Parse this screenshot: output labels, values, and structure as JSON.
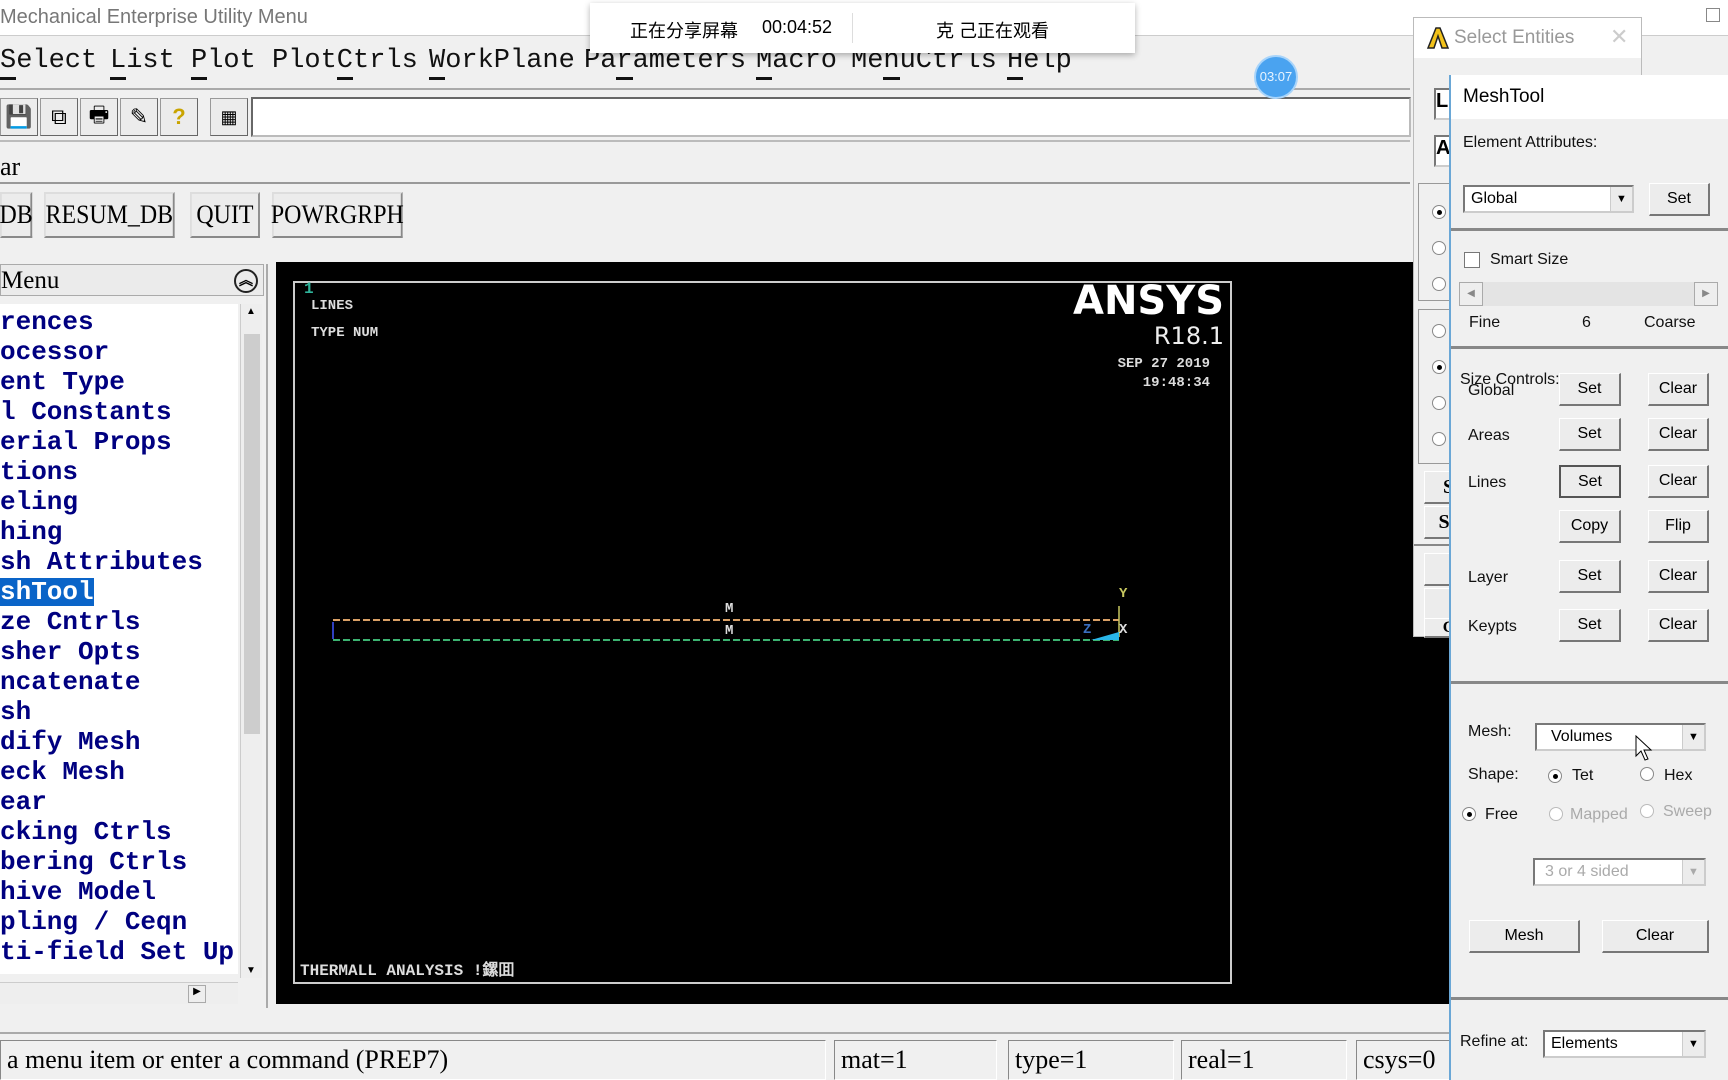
{
  "window": {
    "title": "Mechanical Enterprise Utility Menu"
  },
  "menubar": [
    {
      "label": "Select",
      "key": "S"
    },
    {
      "label": "List",
      "key": "L"
    },
    {
      "label": "Plot",
      "key": "P"
    },
    {
      "label": "PlotCtrls",
      "key": "C"
    },
    {
      "label": "WorkPlane",
      "key": "W"
    },
    {
      "label": "Parameters",
      "key": "r"
    },
    {
      "label": "Macro",
      "key": "M"
    },
    {
      "label": "MenuCtrls",
      "key": "n"
    },
    {
      "label": "Help",
      "key": "H"
    }
  ],
  "toolbar": {
    "icons": [
      "save-icon",
      "resume-icon",
      "print-icon",
      "report-icon",
      "help-icon",
      "keyboard-icon"
    ],
    "command_value": ""
  },
  "toolbar_label": "ar",
  "buttons": [
    "DB",
    "RESUM_DB",
    "QUIT",
    "POWRGRPH"
  ],
  "main_menu": {
    "title": "Menu",
    "items": [
      "rences",
      "ocessor",
      "ent Type",
      "l Constants",
      "erial Props",
      "tions",
      "eling",
      "hing",
      "sh Attributes",
      "shTool",
      "ze Cntrls",
      "sher Opts",
      "ncatenate",
      "sh",
      "dify Mesh",
      "eck Mesh",
      "ear",
      "cking Ctrls",
      "bering Ctrls",
      "hive Model",
      "pling / Ceqn",
      "ti-field Set Up"
    ],
    "selected": "shTool"
  },
  "graphics": {
    "window_number": "1",
    "label1": "LINES",
    "label2": "TYPE NUM",
    "brand": "ANSYS",
    "version": "R18.1",
    "date": "SEP 27 2019",
    "time": "19:48:34",
    "title": "THERMALL ANALYSIS !鏍囬",
    "marker1": "M",
    "marker2": "M",
    "axis_y": "Y",
    "axis_z": "Z",
    "axis_x": "X",
    "colors": {
      "top_line": "#d9a066",
      "bottom_line": "#3cb371",
      "triad": "#29b6e8"
    }
  },
  "status": {
    "prompt": "a menu item or enter a command (PREP7)",
    "mat": "mat=1",
    "type": "type=1",
    "real": "real=1",
    "csys": "csys=0"
  },
  "share_overlay": {
    "status": "正在分享屏幕",
    "timer": "00:04:52",
    "viewers": "克 己正在观看"
  },
  "timer_badge": "03:07",
  "select_entities": {
    "title": "Select Entities",
    "box1": "L",
    "box2": "A",
    "btn1": "S",
    "btn2": "Se",
    "btn3": "C",
    "radios_group1": [
      true,
      false,
      false
    ],
    "radios_group2": [
      false,
      true,
      false,
      false
    ]
  },
  "meshtool": {
    "title": "MeshTool",
    "element_attributes_label": "Element Attributes:",
    "element_attributes_value": "Global",
    "set": "Set",
    "clear": "Clear",
    "smart_size_label": "Smart Size",
    "smart_size_checked": false,
    "fine": "Fine",
    "coarse": "Coarse",
    "size_level": "6",
    "size_controls_label": "Size Controls:",
    "rows": [
      {
        "label": "Global",
        "b1": "Set",
        "b2": "Clear"
      },
      {
        "label": "Areas",
        "b1": "Set",
        "b2": "Clear"
      },
      {
        "label": "Lines",
        "b1": "Set",
        "b2": "Clear"
      },
      {
        "label": "",
        "b1": "Copy",
        "b2": "Flip"
      },
      {
        "label": "Layer",
        "b1": "Set",
        "b2": "Clear"
      },
      {
        "label": "Keypts",
        "b1": "Set",
        "b2": "Clear"
      }
    ],
    "mesh_label": "Mesh:",
    "mesh_value": "Volumes",
    "shape_label": "Shape:",
    "tet": "Tet",
    "hex": "Hex",
    "shape_selected": "Tet",
    "free": "Free",
    "mapped": "Mapped",
    "sweep": "Sweep",
    "method_selected": "Free",
    "sides_value": "3 or 4 sided",
    "mesh_button": "Mesh",
    "clear_button": "Clear",
    "refine_label": "Refine at:",
    "refine_value": "Elements"
  }
}
